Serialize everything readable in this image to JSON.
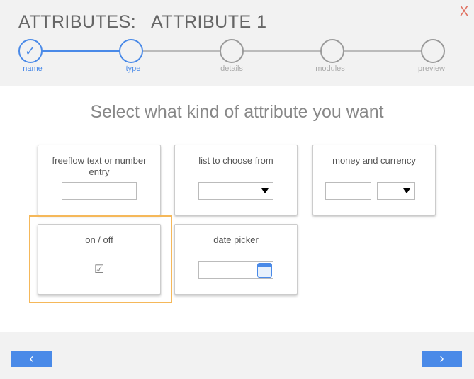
{
  "header": {
    "title": "ATTRIBUTES:   ATTRIBUTE 1",
    "close_label": "X"
  },
  "stepper": {
    "current_step": 2,
    "steps": [
      {
        "label": "name",
        "state": "completed"
      },
      {
        "label": "type",
        "state": "current"
      },
      {
        "label": "details",
        "state": "pending"
      },
      {
        "label": "modules",
        "state": "pending"
      },
      {
        "label": "preview",
        "state": "pending"
      }
    ]
  },
  "main": {
    "heading": "Select what kind of attribute you want",
    "selected_option": "on / off",
    "options": [
      {
        "label": "freeflow text or number entry"
      },
      {
        "label": "list to choose from"
      },
      {
        "label": "money and currency"
      },
      {
        "label": "on / off",
        "checkbox_glyph": "☑"
      },
      {
        "label": "date picker"
      }
    ]
  },
  "footer": {
    "back_label": "‹",
    "next_label": "›"
  },
  "colors": {
    "accent": "#4a8ae8",
    "selection_highlight": "#f5b85a",
    "close": "#e07060"
  }
}
